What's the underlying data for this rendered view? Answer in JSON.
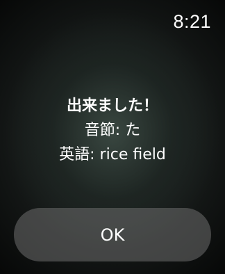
{
  "status_bar": {
    "time": "8:21"
  },
  "alert": {
    "title": "出来ました！",
    "syllable_line": "音節: た",
    "english_line": "英語: rice field",
    "ok_label": "OK"
  }
}
